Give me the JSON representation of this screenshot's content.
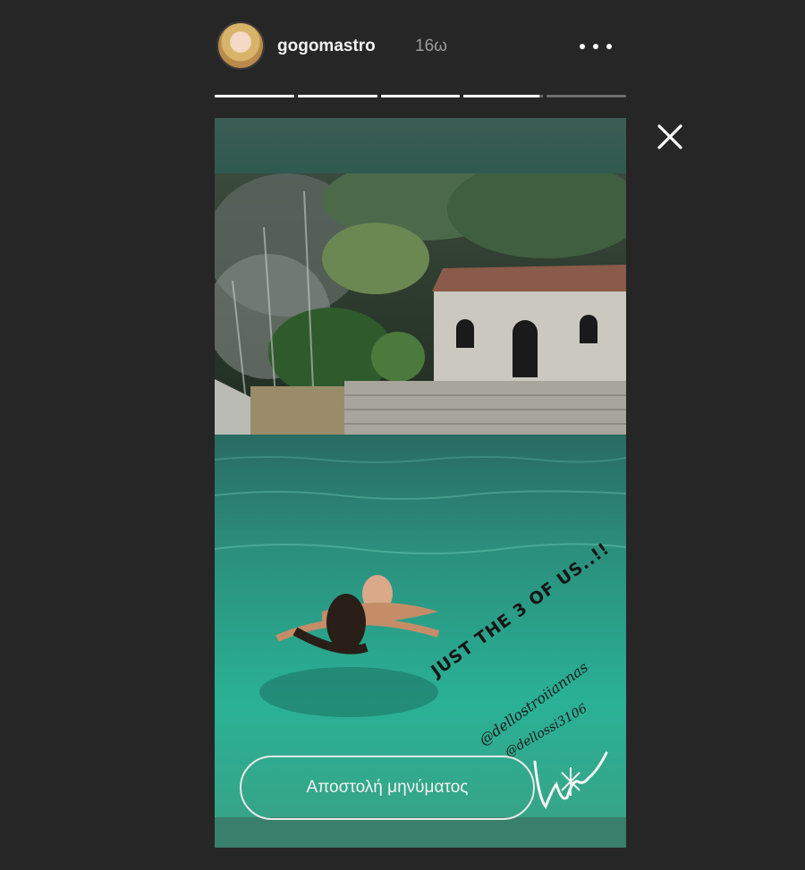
{
  "header": {
    "username": "gogomastro",
    "timestamp": "16ω",
    "more_icon": "more-dots-icon",
    "avatar": "profile-avatar"
  },
  "progress": {
    "segments": 5,
    "completed": 3,
    "current_fill_fraction": 0.95
  },
  "close_icon": "close-icon",
  "story": {
    "caption": "JUST THE 3 OF US..!!",
    "mentions": [
      "@dellostroiiannas",
      "@dellossi3106"
    ],
    "sticker": "love-sticker",
    "reply_placeholder": "Αποστολή μηνύματος"
  },
  "colors": {
    "background": "#262626",
    "water": "#2aa58a",
    "text": "#ffffff"
  }
}
